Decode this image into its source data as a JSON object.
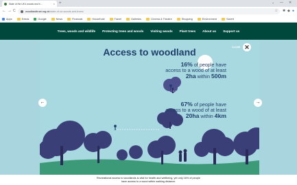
{
  "browser": {
    "tab_title": "State of the UK's woods and tr…",
    "tab_close": "×",
    "new_tab": "+",
    "window_controls": [
      "⌄",
      "—",
      "✕"
    ],
    "nav": {
      "back": "←",
      "forward": "→",
      "reload": "C"
    },
    "url_host": "woodlandtrust.org.uk",
    "url_path": "/state-of-uk-woods-and-trees/",
    "star": "☆",
    "extensions": [
      "✱",
      "◆",
      "●"
    ]
  },
  "bookmarks": [
    {
      "label": "Apps",
      "icon": "apps-grid-icon",
      "color": "#4285f4"
    },
    {
      "label": "Extras",
      "icon": "folder-icon",
      "color": "#f6c945"
    },
    {
      "label": "Google",
      "icon": "google-icon",
      "color": "#34a853"
    },
    {
      "label": "News",
      "icon": "folder-icon",
      "color": "#f6c945"
    },
    {
      "label": "Financial",
      "icon": "folder-icon",
      "color": "#f6c945"
    },
    {
      "label": "Household",
      "icon": "folder-icon",
      "color": "#f6c945"
    },
    {
      "label": "Travel",
      "icon": "folder-icon",
      "color": "#f6c945"
    },
    {
      "label": "Galleries",
      "icon": "folder-icon",
      "color": "#f6c945"
    },
    {
      "label": "Cinema & Theatre",
      "icon": "folder-icon",
      "color": "#f6c945"
    },
    {
      "label": "Shopping",
      "icon": "folder-icon",
      "color": "#f6c945"
    },
    {
      "label": "Environment",
      "icon": "folder-icon",
      "color": "#f6c945"
    },
    {
      "label": "Savert",
      "icon": "folder-icon",
      "color": "#f6c945"
    }
  ],
  "site_nav": [
    "Trees, woods and wildlife",
    "Protecting trees and woods",
    "Visiting woods",
    "Plant trees",
    "About us",
    "Support us"
  ],
  "slide": {
    "title": "Access to woodland",
    "stat1": {
      "pct": "16%",
      "line1": "of people have",
      "line2": "access to a wood of at least",
      "size": "2ha",
      "within": "within",
      "dist": "500m"
    },
    "stat2": {
      "pct": "67%",
      "line1": "of people have",
      "line2": "access to a wood of at least",
      "size": "20ha",
      "within": "within",
      "dist": "4km"
    },
    "close_label": "CLOSE",
    "close_glyph": "✕",
    "prev_glyph": "←",
    "next_glyph": "→"
  },
  "caption": {
    "line1": "Recreational access to woodlands is vital for health and wellbeing, yet only 16% of people",
    "line2": "have access to a wood within walking distance."
  },
  "colors": {
    "nav_bg": "#00473c",
    "sky": "#a8d8e0",
    "title_text": "#1f3f6a",
    "tree_dark": "#3b3f78",
    "tree_mid": "#4d4f8f",
    "grass": "#3c9a78"
  }
}
